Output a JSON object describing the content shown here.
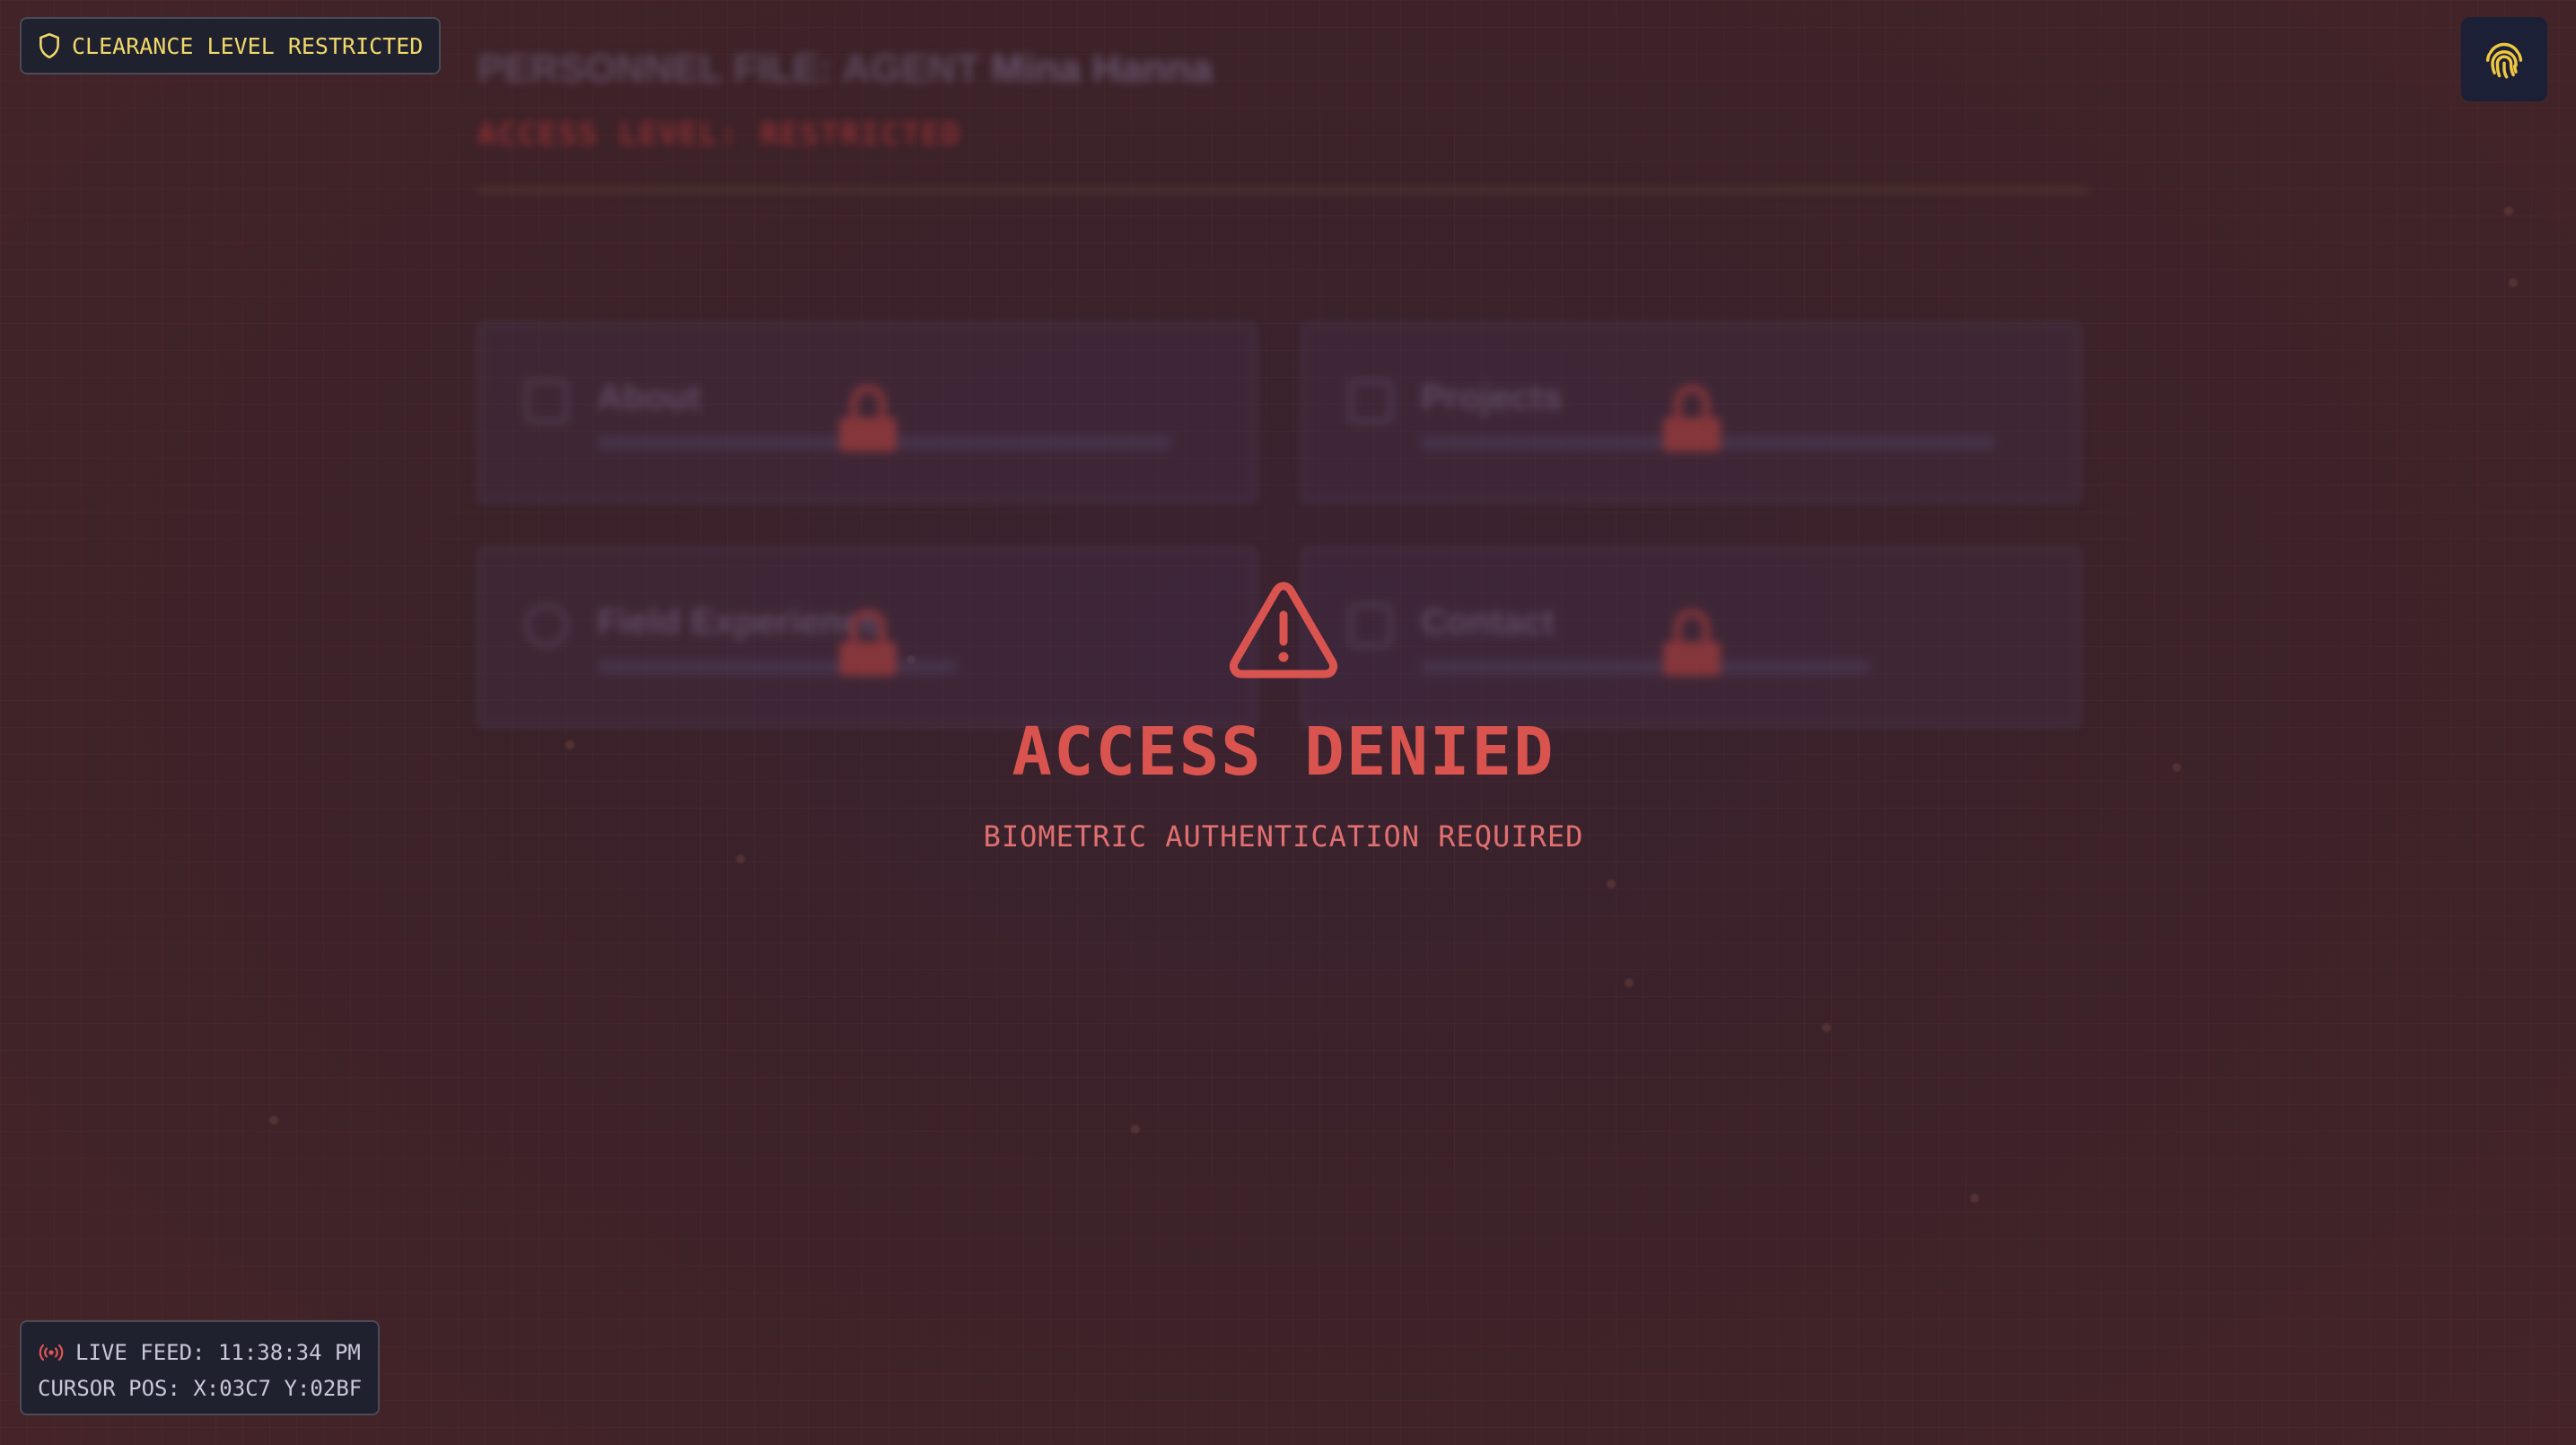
{
  "badge": {
    "label": "CLEARANCE LEVEL RESTRICTED",
    "icon": "shield-icon",
    "color": "#f0d86a"
  },
  "fingerprint_button": {
    "icon": "fingerprint-icon",
    "color": "#f0c840"
  },
  "background_doc": {
    "title_prefix": "PERSONNEL FILE: AGENT ",
    "agent_name": "Mina Hanna",
    "subtitle": "ACCESS LEVEL: RESTRICTED",
    "cards": [
      {
        "title": "About"
      },
      {
        "title": "Projects"
      },
      {
        "title": "Field Experience"
      },
      {
        "title": "Contact"
      }
    ]
  },
  "alert": {
    "icon": "warning-triangle-icon",
    "title": "ACCESS DENIED",
    "message": "BIOMETRIC AUTHENTICATION REQUIRED",
    "color": "#d9534f"
  },
  "feed": {
    "icon": "broadcast-icon",
    "live_label": "LIVE FEED: 11:38:34 PM",
    "cursor_label": "CURSOR POS: X:03C7 Y:02BF"
  }
}
